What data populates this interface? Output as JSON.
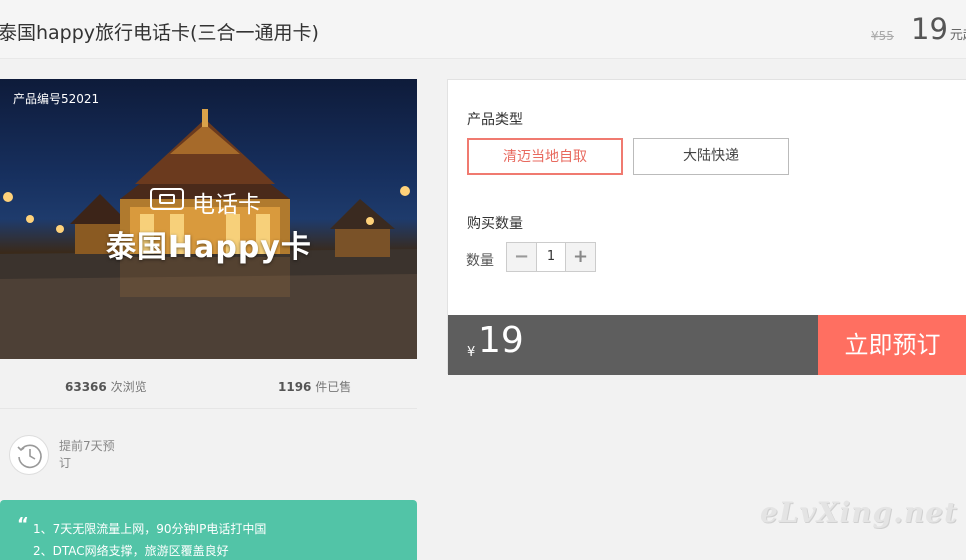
{
  "header": {
    "title": "泰国happy旅行电话卡(三合一通用卡)",
    "old_price": "¥55",
    "price": "19",
    "price_unit": "元起"
  },
  "product_image": {
    "product_no": "产品编号52021",
    "badge": "电话卡",
    "headline": "泰国Happy卡"
  },
  "stats": {
    "views_count": "63366",
    "views_label": "次浏览",
    "sold_count": "1196",
    "sold_label": "件已售"
  },
  "advance": {
    "icon": "history-clock-icon",
    "text": "提前7天预订"
  },
  "features": {
    "line1": "1、7天无限流量上网，90分钟IP电话打中国",
    "line2": "2、DTAC网络支撑，旅游区覆盖良好"
  },
  "booking": {
    "type_label": "产品类型",
    "options": [
      "清迈当地自取",
      "大陆快递"
    ],
    "selected_option": "清迈当地自取",
    "qty_section_label": "购买数量",
    "qty_label": "数量",
    "qty_value": "1",
    "currency": "¥",
    "total": "19",
    "book_button": "立即预订"
  },
  "watermark": "eLvXing.net",
  "colors": {
    "accent": "#ff6f61",
    "selected_border": "#f07a70",
    "features_bg": "#52c4a7",
    "bar_bg": "#5e5e5e"
  }
}
